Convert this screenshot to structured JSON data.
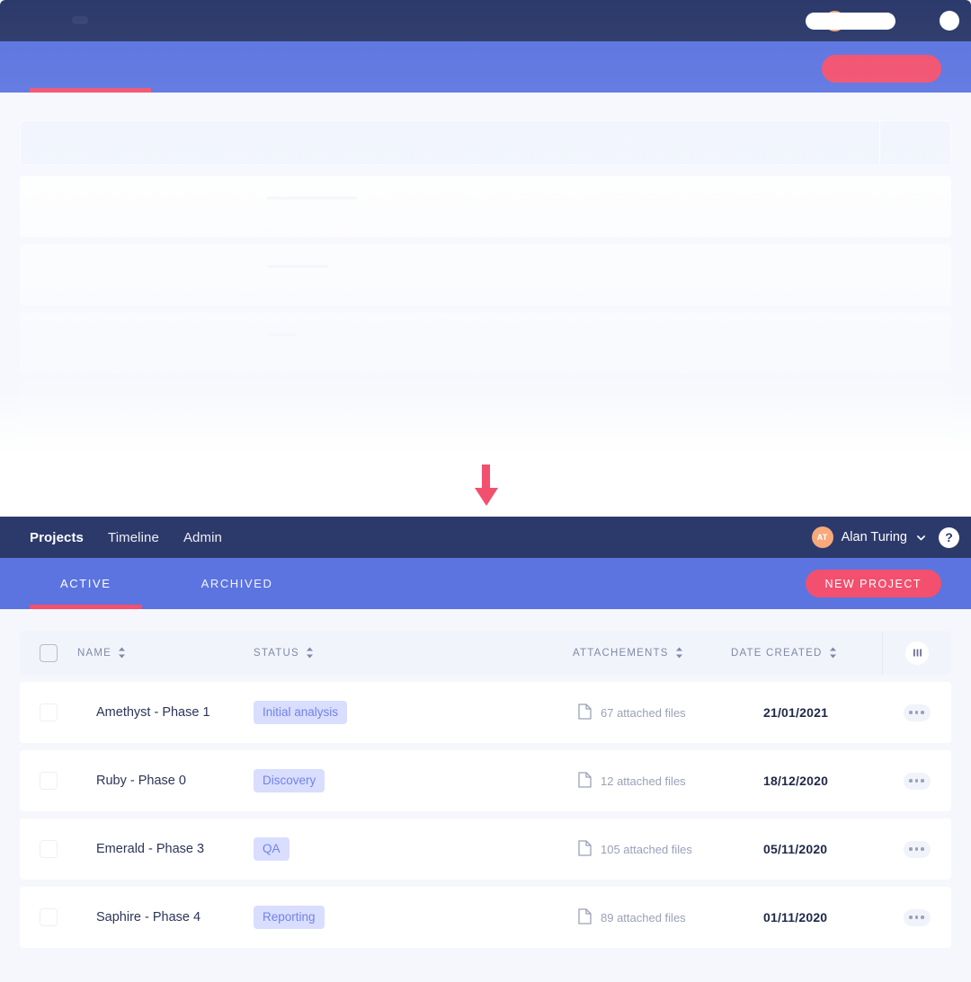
{
  "brand": {
    "navy": "#2c3a6b",
    "periwinkle": "#5c74e0",
    "accent_pink": "#f2506e",
    "badge_bg": "#d9deff",
    "badge_text": "#7183e8",
    "page_bg": "#f6f7fc"
  },
  "navbar": {
    "links": [
      {
        "label": "Projects",
        "active": true
      },
      {
        "label": "Timeline",
        "active": false
      },
      {
        "label": "Admin",
        "active": false
      }
    ],
    "user": {
      "initials": "AT",
      "name": "Alan Turing",
      "caret_icon": "chevron-down-icon"
    },
    "help_label": "?"
  },
  "subnav": {
    "tabs": [
      {
        "label": "ACTIVE",
        "active": true
      },
      {
        "label": "ARCHIVED",
        "active": false
      }
    ],
    "cta_label": "NEW PROJECT"
  },
  "table": {
    "columns": [
      {
        "key": "check",
        "label": "",
        "sortable": false
      },
      {
        "key": "name",
        "label": "NAME",
        "sortable": true
      },
      {
        "key": "status",
        "label": "STATUS",
        "sortable": true
      },
      {
        "key": "att",
        "label": "ATTACHEMENTS",
        "sortable": true
      },
      {
        "key": "date",
        "label": "DATE CREATED",
        "sortable": true
      },
      {
        "key": "more",
        "label": "",
        "sortable": false
      }
    ],
    "columns_icon": "columns-settings-icon",
    "rows": [
      {
        "name": "Amethyst - Phase 1",
        "status": "Initial analysis",
        "attachments": "67 attached files",
        "date": "21/01/2021",
        "checked": false
      },
      {
        "name": "Ruby - Phase 0",
        "status": "Discovery",
        "attachments": "12 attached files",
        "date": "18/12/2020",
        "checked": false
      },
      {
        "name": "Emerald - Phase 3",
        "status": "QA",
        "attachments": "105 attached files",
        "date": "05/11/2020",
        "checked": false
      },
      {
        "name": "Saphire - Phase 4",
        "status": "Reporting",
        "attachments": "89 attached files",
        "date": "01/11/2020",
        "checked": false
      }
    ]
  },
  "annotation": {
    "arrow_icon": "arrow-down-icon"
  }
}
